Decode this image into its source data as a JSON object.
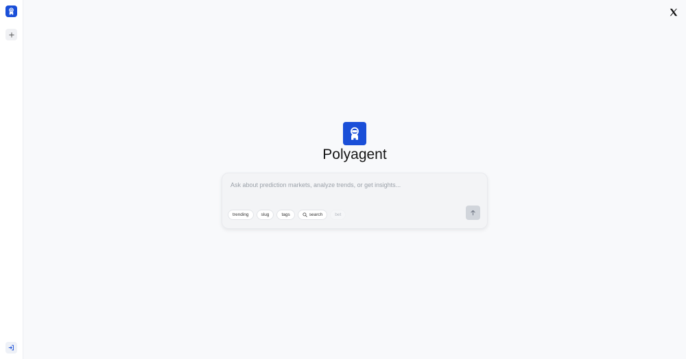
{
  "app": {
    "title": "Polyagent"
  },
  "composer": {
    "placeholder": "Ask about prediction markets, analyze trends, or get insights..."
  },
  "chips": [
    {
      "label": "trending"
    },
    {
      "label": "slug"
    },
    {
      "label": "tags"
    },
    {
      "label": "search",
      "icon": "search-icon"
    },
    {
      "label": "bet",
      "disabled": true
    }
  ],
  "icons": {
    "logo": "astronaut-icon",
    "new_chat": "plus-icon",
    "login": "sign-in-icon",
    "social": "x-logo-icon",
    "send": "arrow-up-icon"
  },
  "colors": {
    "brand": "#1a4fd8",
    "background": "#f8f9fb",
    "send_disabled": "#d1d5db"
  }
}
